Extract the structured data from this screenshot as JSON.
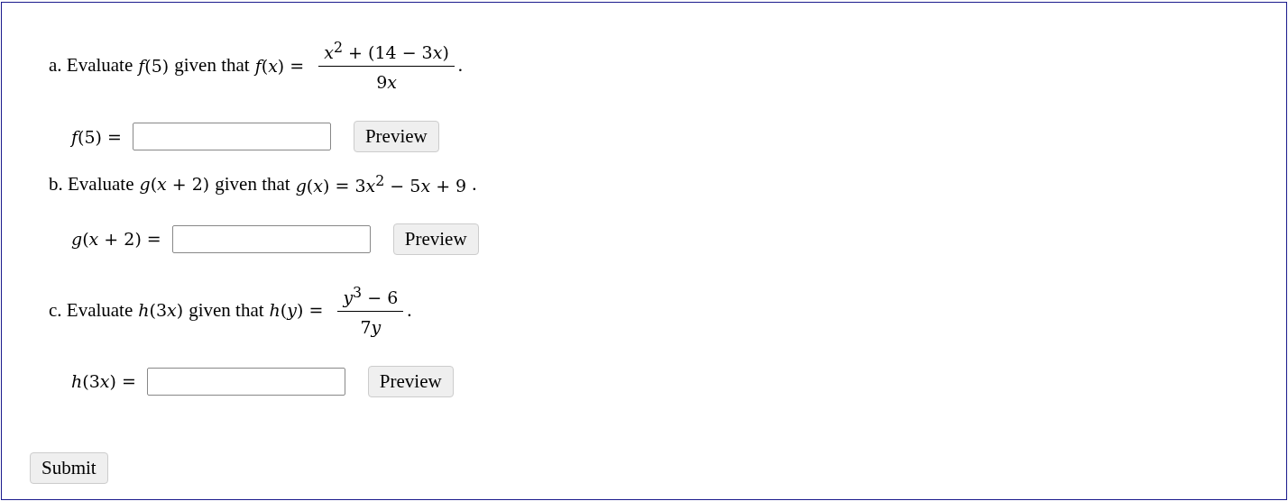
{
  "questions": [
    {
      "parts": [
        {
          "kind": "text",
          "text": "a. Evaluate "
        },
        {
          "kind": "math",
          "text": "f(5)"
        },
        {
          "kind": "text",
          "text": " given that "
        },
        {
          "kind": "math",
          "text": "f(x) ="
        },
        {
          "kind": "fraction",
          "numerator": "x$^{2}$ + (14 − 3x)",
          "denominator": "9x"
        },
        {
          "kind": "text",
          "text": "."
        }
      ],
      "answer_label": "f(5) =",
      "button": "Preview"
    },
    {
      "parts": [
        {
          "kind": "text",
          "text": "b. Evaluate "
        },
        {
          "kind": "math",
          "text": "g(x + 2)"
        },
        {
          "kind": "text",
          "text": " given that "
        },
        {
          "kind": "math",
          "text": "g(x) = 3x$^{2}$ − 5x + 9"
        },
        {
          "kind": "text",
          "text": "."
        }
      ],
      "answer_label": "g(x + 2) =",
      "button": "Preview"
    },
    {
      "parts": [
        {
          "kind": "text",
          "text": "c. Evaluate "
        },
        {
          "kind": "math",
          "text": "h(3x)"
        },
        {
          "kind": "text",
          "text": " given that "
        },
        {
          "kind": "math",
          "text": "h(y) ="
        },
        {
          "kind": "fraction",
          "numerator": "y$^{3}$ − 6",
          "denominator": "7y"
        },
        {
          "kind": "text",
          "text": "."
        }
      ],
      "answer_label": "h(3x) =",
      "button": "Preview"
    }
  ],
  "submit": "Submit"
}
